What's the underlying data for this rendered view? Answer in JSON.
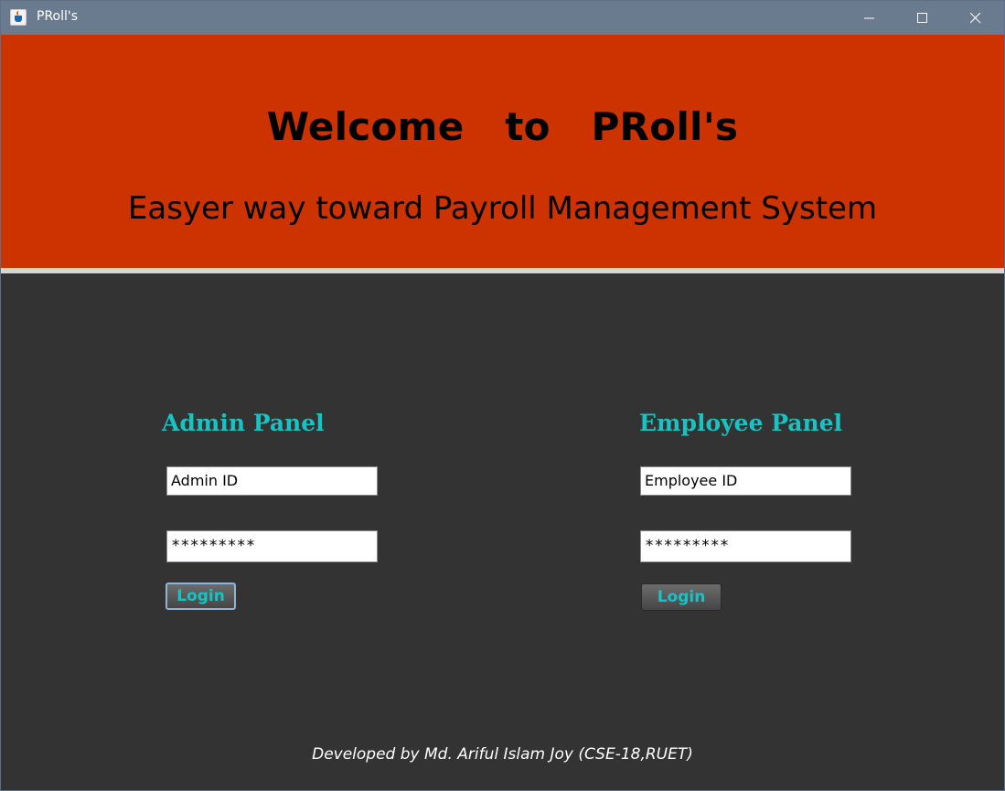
{
  "window": {
    "title": "PRoll's",
    "controls": {
      "minimize": "minimize-icon",
      "maximize": "maximize-icon",
      "close": "close-icon"
    }
  },
  "header": {
    "welcome": "Welcome   to   PRoll's",
    "tagline": "Easyer way toward Payroll Management System",
    "background": "#cc3300"
  },
  "admin_panel": {
    "title": "Admin Panel",
    "id_value": "Admin ID",
    "password_value": "*********",
    "login_label": "Login"
  },
  "employee_panel": {
    "title": "Employee Panel",
    "id_value": "Employee ID",
    "password_value": "*********",
    "login_label": "Login"
  },
  "footer": {
    "credit": "Developed by Md. Ariful Islam Joy (CSE-18,RUET)"
  },
  "colors": {
    "accent": "#17c3c3",
    "body_background": "#333333",
    "titlebar": "#6b7b8f"
  }
}
